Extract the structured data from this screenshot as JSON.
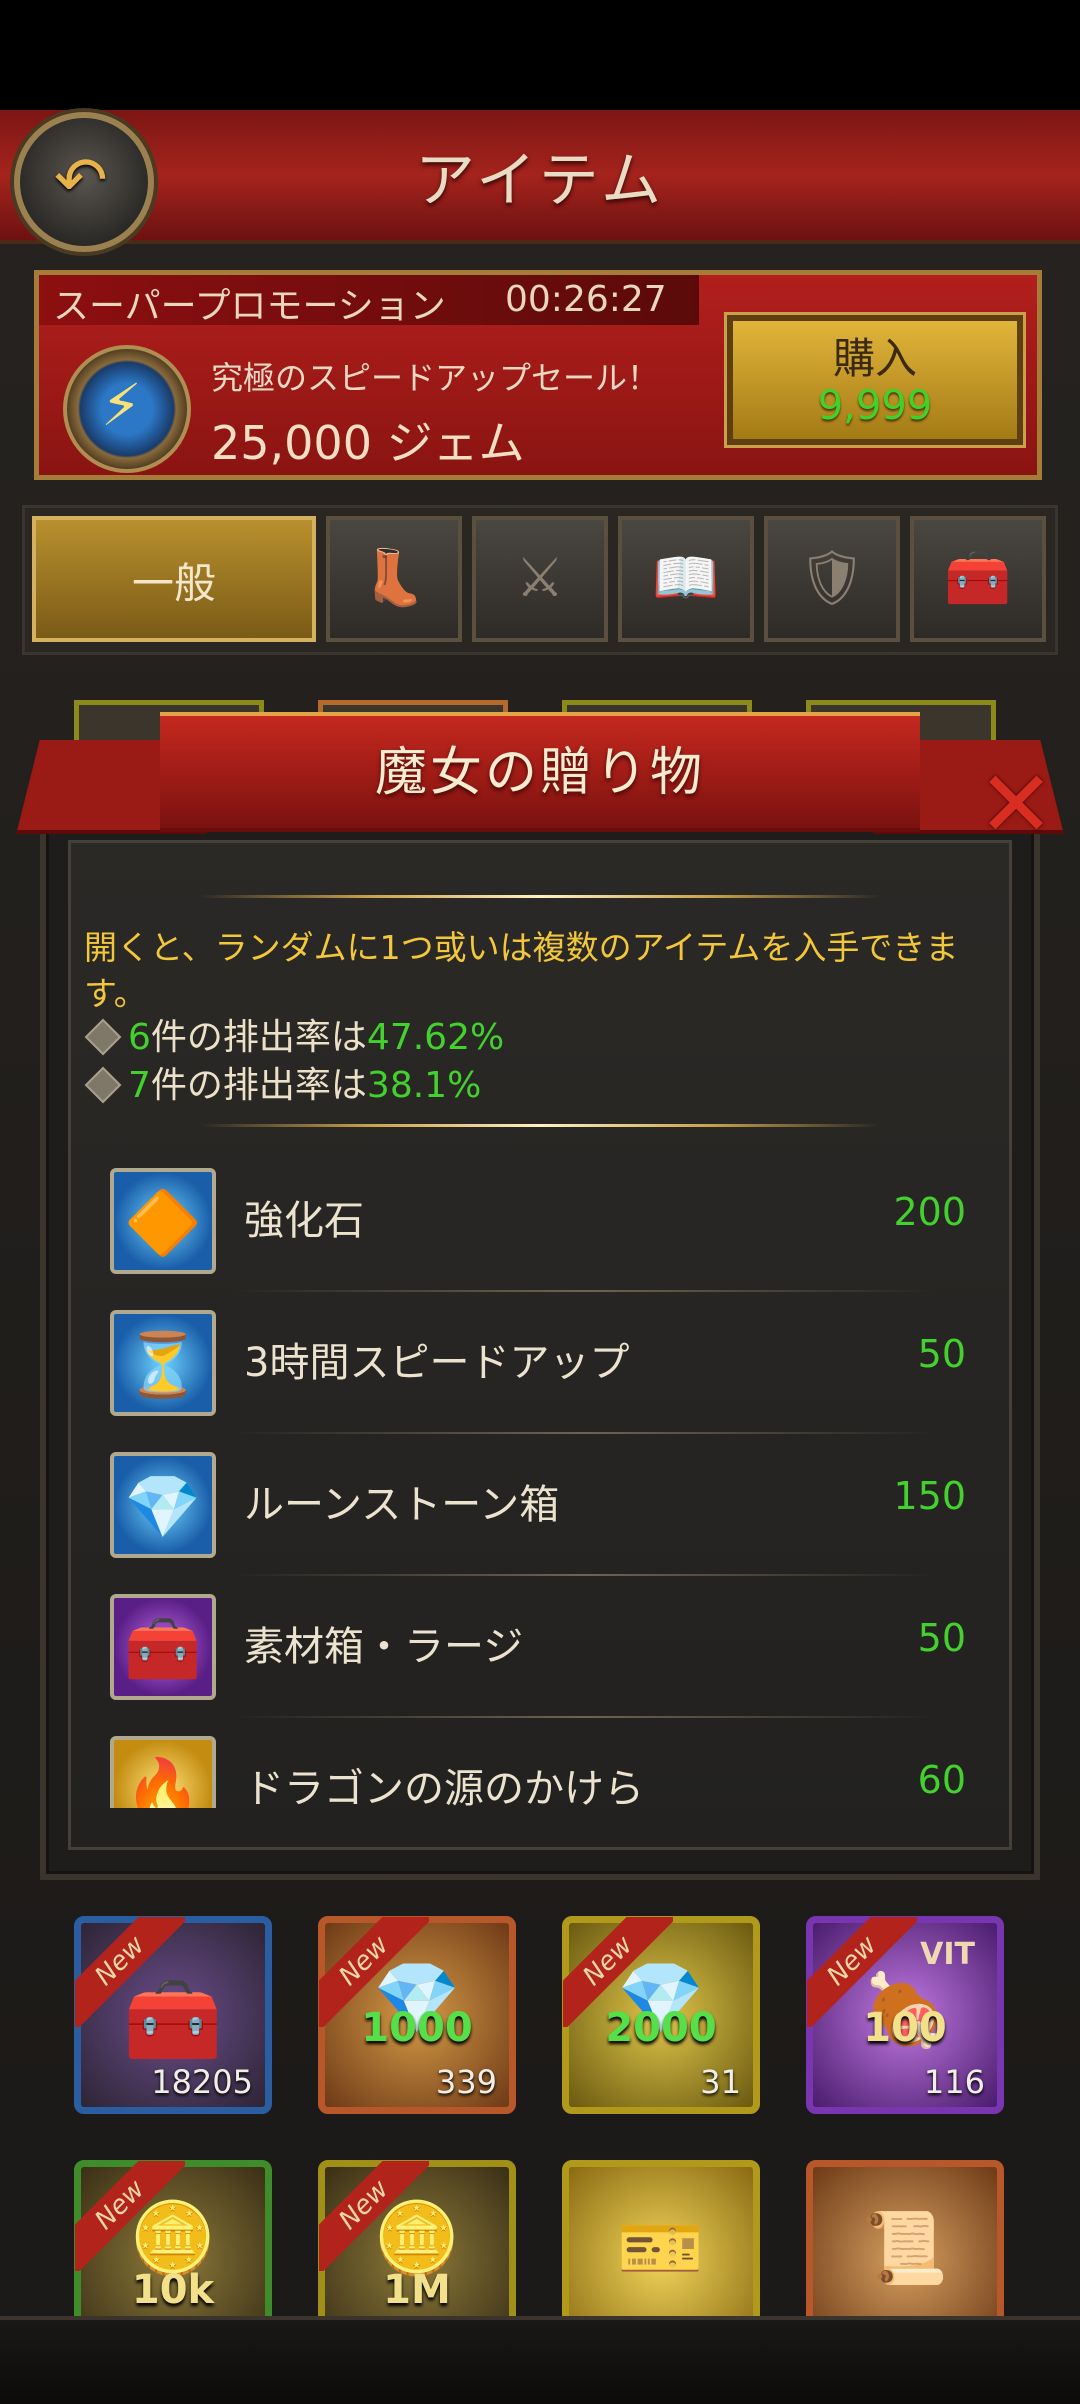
{
  "header": {
    "title": "アイテム"
  },
  "promo": {
    "label": "スーパープロモーション",
    "timer": "00:26:27",
    "subtitle": "究極のスピードアップセール！",
    "gems": "25,000 ジェム",
    "buy_label": "購入",
    "buy_price": "9,999"
  },
  "tabs": {
    "general": "一般"
  },
  "modal": {
    "title": "魔女の贈り物",
    "description": "開くと、ランダムに1つ或いは複数のアイテムを入手できます。",
    "rates": [
      {
        "count": "6",
        "text": "件の排出率は",
        "percent": "47.62%"
      },
      {
        "count": "7",
        "text": "件の排出率は",
        "percent": "38.1%"
      }
    ],
    "items": [
      {
        "name": "強化石",
        "count": "200"
      },
      {
        "name": "3時間スピードアップ",
        "count": "50"
      },
      {
        "name": "ルーンストーン箱",
        "count": "150"
      },
      {
        "name": "素材箱・ラージ",
        "count": "50"
      },
      {
        "name": "ドラゴンの源のかけら",
        "count": "60"
      }
    ]
  },
  "grid": {
    "new_badge": "New",
    "slots": [
      {
        "label": "",
        "count": "18205"
      },
      {
        "label": "1000",
        "count": "339"
      },
      {
        "label": "2000",
        "count": "31"
      },
      {
        "label": "100",
        "tag": "VIT",
        "count": "116"
      },
      {
        "label": "10k",
        "count": ""
      },
      {
        "label": "1M",
        "count": ""
      },
      {
        "label": "",
        "count": ""
      },
      {
        "label": "",
        "count": ""
      }
    ]
  },
  "colors": {
    "accent_green": "#43d12e",
    "gold": "#f2c73a",
    "red": "#a5231d"
  }
}
